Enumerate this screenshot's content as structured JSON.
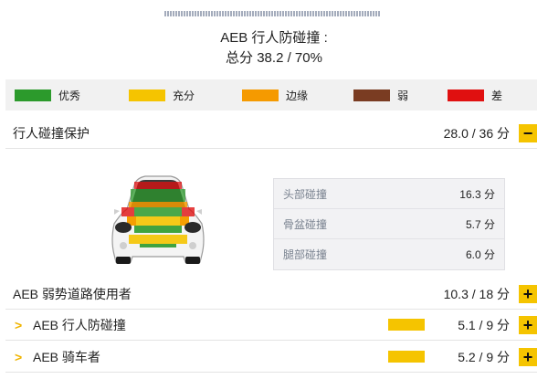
{
  "header": {
    "title": "AEB 行人防碰撞 :",
    "total": "总分 38.2 / 70%"
  },
  "legend": [
    {
      "label": "优秀",
      "color": "#2c9a2c"
    },
    {
      "label": "充分",
      "color": "#f5c400"
    },
    {
      "label": "边缘",
      "color": "#f59a00"
    },
    {
      "label": "弱",
      "color": "#7a3c22"
    },
    {
      "label": "差",
      "color": "#e01010"
    }
  ],
  "pedestrian": {
    "label": "行人碰撞保护",
    "score": "28.0 / 36 分",
    "toggle": "−",
    "details": [
      {
        "label": "头部碰撞",
        "value": "16.3 分"
      },
      {
        "label": "骨盆碰撞",
        "value": "5.7 分"
      },
      {
        "label": "腿部碰撞",
        "value": "6.0 分"
      }
    ]
  },
  "vru": {
    "label": "AEB 弱势道路使用者",
    "score": "10.3 / 18 分",
    "toggle": "+"
  },
  "sub_items": [
    {
      "chevron": ">",
      "label": "AEB 行人防碰撞",
      "score": "5.1 / 9 分",
      "toggle": "+",
      "rating_color": "#f5c400"
    },
    {
      "chevron": ">",
      "label": "AEB 骑车者",
      "score": "5.2 / 9 分",
      "toggle": "+",
      "rating_color": "#f5c400"
    }
  ]
}
